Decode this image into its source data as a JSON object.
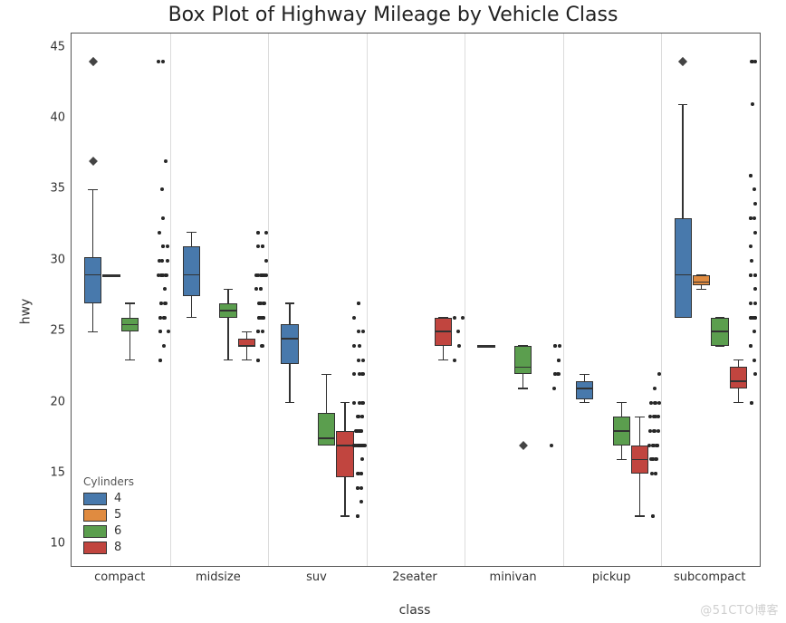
{
  "title": "Box Plot of Highway Mileage by Vehicle Class",
  "xlabel": "class",
  "ylabel": "hwy",
  "watermark": "@51CTO博客",
  "legend": {
    "title": "Cylinders",
    "items": [
      {
        "label": "4",
        "color": "#4879AC"
      },
      {
        "label": "5",
        "color": "#E08B40"
      },
      {
        "label": "6",
        "color": "#5B9E4E"
      },
      {
        "label": "8",
        "color": "#C1453F"
      }
    ]
  },
  "yticks": [
    10,
    15,
    20,
    25,
    30,
    35,
    40,
    45
  ],
  "categories": [
    "compact",
    "midsize",
    "suv",
    "2seater",
    "minivan",
    "pickup",
    "subcompact"
  ],
  "chart_data": {
    "type": "boxplot",
    "title": "Box Plot of Highway Mileage by Vehicle Class",
    "xlabel": "class",
    "ylabel": "hwy",
    "ylim": [
      8.5,
      46
    ],
    "categories": [
      "compact",
      "midsize",
      "suv",
      "2seater",
      "minivan",
      "pickup",
      "subcompact"
    ],
    "hue": "Cylinders",
    "hue_order": [
      4,
      5,
      6,
      8
    ],
    "colors": {
      "4": "#4879AC",
      "5": "#E08B40",
      "6": "#5B9E4E",
      "8": "#C1453F"
    },
    "boxes": [
      {
        "class": "compact",
        "cyl": 4,
        "q1": 27,
        "median": 29,
        "q3": 30.25,
        "whisker_low": 25,
        "whisker_high": 35,
        "outliers": [
          37,
          44,
          44
        ]
      },
      {
        "class": "compact",
        "cyl": 5,
        "q1": 29,
        "median": 29,
        "q3": 29,
        "whisker_low": 29,
        "whisker_high": 29,
        "outliers": []
      },
      {
        "class": "compact",
        "cyl": 6,
        "q1": 25,
        "median": 25.5,
        "q3": 26,
        "whisker_low": 23,
        "whisker_high": 27,
        "outliers": []
      },
      {
        "class": "midsize",
        "cyl": 4,
        "q1": 27.5,
        "median": 29,
        "q3": 31,
        "whisker_low": 26,
        "whisker_high": 32,
        "outliers": []
      },
      {
        "class": "midsize",
        "cyl": 6,
        "q1": 26,
        "median": 26.5,
        "q3": 27,
        "whisker_low": 23,
        "whisker_high": 28,
        "outliers": []
      },
      {
        "class": "midsize",
        "cyl": 8,
        "q1": 24,
        "median": 24,
        "q3": 24.5,
        "whisker_low": 23,
        "whisker_high": 25,
        "outliers": []
      },
      {
        "class": "suv",
        "cyl": 4,
        "q1": 22.75,
        "median": 24.5,
        "q3": 25.5,
        "whisker_low": 20,
        "whisker_high": 27,
        "outliers": []
      },
      {
        "class": "suv",
        "cyl": 6,
        "q1": 17,
        "median": 17.5,
        "q3": 19.25,
        "whisker_low": 17,
        "whisker_high": 22,
        "outliers": []
      },
      {
        "class": "suv",
        "cyl": 8,
        "q1": 14.75,
        "median": 17,
        "q3": 18,
        "whisker_low": 12,
        "whisker_high": 20,
        "outliers": []
      },
      {
        "class": "2seater",
        "cyl": 8,
        "q1": 24,
        "median": 25,
        "q3": 26,
        "whisker_low": 23,
        "whisker_high": 26,
        "outliers": []
      },
      {
        "class": "minivan",
        "cyl": 4,
        "q1": 24,
        "median": 24,
        "q3": 24,
        "whisker_low": 24,
        "whisker_high": 24,
        "outliers": []
      },
      {
        "class": "minivan",
        "cyl": 6,
        "q1": 22,
        "median": 22.5,
        "q3": 24,
        "whisker_low": 21,
        "whisker_high": 24,
        "outliers": [
          17
        ]
      },
      {
        "class": "pickup",
        "cyl": 4,
        "q1": 20.25,
        "median": 21,
        "q3": 21.5,
        "whisker_low": 20,
        "whisker_high": 22,
        "outliers": []
      },
      {
        "class": "pickup",
        "cyl": 6,
        "q1": 17,
        "median": 18,
        "q3": 19,
        "whisker_low": 16,
        "whisker_high": 20,
        "outliers": []
      },
      {
        "class": "pickup",
        "cyl": 8,
        "q1": 15,
        "median": 16,
        "q3": 17,
        "whisker_low": 12,
        "whisker_high": 19,
        "outliers": []
      },
      {
        "class": "subcompact",
        "cyl": 4,
        "q1": 26,
        "median": 29,
        "q3": 33,
        "whisker_low": 26,
        "whisker_high": 41,
        "outliers": [
          44,
          44
        ]
      },
      {
        "class": "subcompact",
        "cyl": 5,
        "q1": 28.25,
        "median": 28.5,
        "q3": 29,
        "whisker_low": 28,
        "whisker_high": 29,
        "outliers": []
      },
      {
        "class": "subcompact",
        "cyl": 6,
        "q1": 24,
        "median": 25,
        "q3": 26,
        "whisker_low": 24,
        "whisker_high": 26,
        "outliers": []
      },
      {
        "class": "subcompact",
        "cyl": 8,
        "q1": 21,
        "median": 21.5,
        "q3": 22.5,
        "whisker_low": 20,
        "whisker_high": 23,
        "outliers": []
      }
    ],
    "stripplot": {
      "compact": [
        23,
        23,
        24,
        25,
        25,
        25,
        26,
        26,
        26,
        26,
        26,
        27,
        27,
        27,
        27,
        28,
        29,
        29,
        29,
        29,
        29,
        29,
        29,
        29,
        29,
        29,
        30,
        30,
        30,
        31,
        31,
        31,
        32,
        33,
        35,
        37,
        44,
        44
      ],
      "midsize": [
        23,
        23,
        24,
        24,
        25,
        25,
        25,
        26,
        26,
        26,
        26,
        26,
        26,
        27,
        27,
        27,
        27,
        27,
        27,
        27,
        28,
        28,
        28,
        29,
        29,
        29,
        29,
        29,
        29,
        29,
        29,
        30,
        31,
        31,
        31,
        32,
        32,
        32
      ],
      "suv": [
        12,
        12,
        13,
        14,
        14,
        14,
        15,
        15,
        15,
        15,
        16,
        17,
        17,
        17,
        17,
        17,
        17,
        17,
        17,
        17,
        17,
        17,
        17,
        17,
        18,
        18,
        18,
        18,
        18,
        18,
        18,
        18,
        18,
        19,
        19,
        19,
        19,
        19,
        20,
        20,
        20,
        20,
        22,
        22,
        22,
        22,
        23,
        23,
        24,
        24,
        25,
        25,
        26,
        27,
        27
      ],
      "2seater": [
        23,
        24,
        25,
        26,
        26
      ],
      "minivan": [
        17,
        21,
        22,
        22,
        22,
        22,
        23,
        23,
        24,
        24,
        24
      ],
      "pickup": [
        12,
        12,
        15,
        15,
        15,
        16,
        16,
        16,
        16,
        16,
        17,
        17,
        17,
        17,
        17,
        17,
        17,
        17,
        18,
        18,
        18,
        18,
        19,
        19,
        19,
        19,
        20,
        20,
        20,
        20,
        21,
        22
      ],
      "subcompact": [
        20,
        20,
        22,
        23,
        24,
        24,
        25,
        26,
        26,
        26,
        26,
        26,
        26,
        27,
        27,
        28,
        29,
        29,
        29,
        29,
        30,
        31,
        32,
        33,
        33,
        33,
        34,
        35,
        36,
        36,
        41,
        44,
        44,
        44
      ]
    }
  }
}
